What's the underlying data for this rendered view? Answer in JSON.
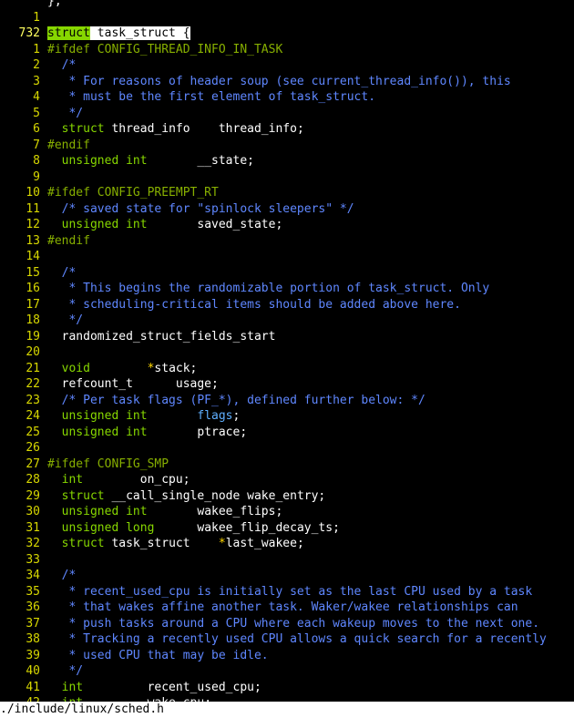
{
  "editor": {
    "lines": [
      {
        "num": "",
        "tokens": [
          {
            "t": "};",
            "c": "plain"
          }
        ]
      },
      {
        "num": "1",
        "tokens": []
      },
      {
        "num": "732",
        "current": true,
        "tokens": [
          {
            "t": "struct",
            "c": "hlkw"
          },
          {
            "t": " task_struct ",
            "c": "hl"
          },
          {
            "t": "{",
            "c": "cursor"
          }
        ]
      },
      {
        "num": "1",
        "tokens": [
          {
            "t": "#ifdef CONFIG_THREAD_INFO_IN_TASK",
            "c": "pp"
          }
        ]
      },
      {
        "num": "2",
        "tokens": [
          {
            "t": "  /*",
            "c": "com"
          }
        ]
      },
      {
        "num": "3",
        "tokens": [
          {
            "t": "   * For reasons of header soup (see current_thread_info()), this",
            "c": "com"
          }
        ]
      },
      {
        "num": "4",
        "tokens": [
          {
            "t": "   * must be the first element of task_struct.",
            "c": "com"
          }
        ]
      },
      {
        "num": "5",
        "tokens": [
          {
            "t": "   */",
            "c": "com"
          }
        ]
      },
      {
        "num": "6",
        "tokens": [
          {
            "t": "  struct",
            "c": "kw"
          },
          {
            "t": " thread_info    thread_info;",
            "c": "plain"
          }
        ]
      },
      {
        "num": "7",
        "tokens": [
          {
            "t": "#endif",
            "c": "pp"
          }
        ]
      },
      {
        "num": "8",
        "tokens": [
          {
            "t": "  unsigned int",
            "c": "type"
          },
          {
            "t": "       __state;",
            "c": "plain"
          }
        ]
      },
      {
        "num": "9",
        "tokens": []
      },
      {
        "num": "10",
        "tokens": [
          {
            "t": "#ifdef CONFIG_PREEMPT_RT",
            "c": "pp"
          }
        ]
      },
      {
        "num": "11",
        "tokens": [
          {
            "t": "  /* saved state for \"spinlock sleepers\" */",
            "c": "com"
          }
        ]
      },
      {
        "num": "12",
        "tokens": [
          {
            "t": "  unsigned int",
            "c": "type"
          },
          {
            "t": "       saved_state;",
            "c": "plain"
          }
        ]
      },
      {
        "num": "13",
        "tokens": [
          {
            "t": "#endif",
            "c": "pp"
          }
        ]
      },
      {
        "num": "14",
        "tokens": []
      },
      {
        "num": "15",
        "tokens": [
          {
            "t": "  /*",
            "c": "com"
          }
        ]
      },
      {
        "num": "16",
        "tokens": [
          {
            "t": "   * This begins the randomizable portion of task_struct. Only",
            "c": "com"
          }
        ]
      },
      {
        "num": "17",
        "tokens": [
          {
            "t": "   * scheduling-critical items should be added above here.",
            "c": "com"
          }
        ]
      },
      {
        "num": "18",
        "tokens": [
          {
            "t": "   */",
            "c": "com"
          }
        ]
      },
      {
        "num": "19",
        "tokens": [
          {
            "t": "  randomized_struct_fields_start",
            "c": "plain"
          }
        ]
      },
      {
        "num": "20",
        "tokens": []
      },
      {
        "num": "21",
        "tokens": [
          {
            "t": "  void",
            "c": "type"
          },
          {
            "t": "        ",
            "c": "plain"
          },
          {
            "t": "*",
            "c": "star"
          },
          {
            "t": "stack;",
            "c": "plain"
          }
        ]
      },
      {
        "num": "22",
        "tokens": [
          {
            "t": "  refcount_t      usage;",
            "c": "plain"
          }
        ]
      },
      {
        "num": "23",
        "tokens": [
          {
            "t": "  /* Per task flags (PF_*), defined further below: */",
            "c": "com"
          }
        ]
      },
      {
        "num": "24",
        "tokens": [
          {
            "t": "  unsigned int",
            "c": "type"
          },
          {
            "t": "       ",
            "c": "plain"
          },
          {
            "t": "flags",
            "c": "field"
          },
          {
            "t": ";",
            "c": "plain"
          }
        ]
      },
      {
        "num": "25",
        "tokens": [
          {
            "t": "  unsigned int",
            "c": "type"
          },
          {
            "t": "       ptrace;",
            "c": "plain"
          }
        ]
      },
      {
        "num": "26",
        "tokens": []
      },
      {
        "num": "27",
        "tokens": [
          {
            "t": "#ifdef CONFIG_SMP",
            "c": "pp"
          }
        ]
      },
      {
        "num": "28",
        "tokens": [
          {
            "t": "  int",
            "c": "type"
          },
          {
            "t": "        on_cpu;",
            "c": "plain"
          }
        ]
      },
      {
        "num": "29",
        "tokens": [
          {
            "t": "  struct",
            "c": "kw"
          },
          {
            "t": " __call_single_node wake_entry;",
            "c": "plain"
          }
        ]
      },
      {
        "num": "30",
        "tokens": [
          {
            "t": "  unsigned int",
            "c": "type"
          },
          {
            "t": "       wakee_flips;",
            "c": "plain"
          }
        ]
      },
      {
        "num": "31",
        "tokens": [
          {
            "t": "  unsigned long",
            "c": "type"
          },
          {
            "t": "      wakee_flip_decay_ts;",
            "c": "plain"
          }
        ]
      },
      {
        "num": "32",
        "tokens": [
          {
            "t": "  struct",
            "c": "kw"
          },
          {
            "t": " task_struct    ",
            "c": "plain"
          },
          {
            "t": "*",
            "c": "star"
          },
          {
            "t": "last_wakee;",
            "c": "plain"
          }
        ]
      },
      {
        "num": "33",
        "tokens": []
      },
      {
        "num": "34",
        "tokens": [
          {
            "t": "  /*",
            "c": "com"
          }
        ]
      },
      {
        "num": "35",
        "tokens": [
          {
            "t": "   * recent_used_cpu is initially set as the last CPU used by a task",
            "c": "com"
          }
        ]
      },
      {
        "num": "36",
        "tokens": [
          {
            "t": "   * that wakes affine another task. Waker/wakee relationships can",
            "c": "com"
          }
        ]
      },
      {
        "num": "37",
        "tokens": [
          {
            "t": "   * push tasks around a CPU where each wakeup moves to the next one.",
            "c": "com"
          }
        ]
      },
      {
        "num": "38",
        "tokens": [
          {
            "t": "   * Tracking a recently used CPU allows a quick search for a recently",
            "c": "com"
          }
        ]
      },
      {
        "num": "39",
        "tokens": [
          {
            "t": "   * used CPU that may be idle.",
            "c": "com"
          }
        ]
      },
      {
        "num": "40",
        "tokens": [
          {
            "t": "   */",
            "c": "com"
          }
        ]
      },
      {
        "num": "41",
        "tokens": [
          {
            "t": "  int",
            "c": "type"
          },
          {
            "t": "         recent_used_cpu;",
            "c": "plain"
          }
        ]
      },
      {
        "num": "42",
        "tokens": [
          {
            "t": "  int",
            "c": "type"
          },
          {
            "t": "         wake_cpu;",
            "c": "plain"
          }
        ]
      }
    ]
  },
  "status": {
    "file_path": "./include/linux/sched.h"
  },
  "colors": {
    "background": "#000000",
    "line_number": "#d7d700",
    "keyword": "#87d700",
    "preprocessor": "#87af00",
    "comment": "#5f87ff",
    "plain": "#ffffff",
    "highlight_bg": "#ffffff"
  }
}
